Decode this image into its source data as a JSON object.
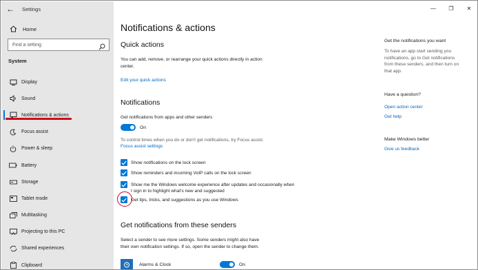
{
  "window": {
    "title": "Settings",
    "controls": [
      "—",
      "❐",
      "✕"
    ]
  },
  "sidebar": {
    "home_label": "Home",
    "search_placeholder": "Find a setting",
    "section_label": "System",
    "items": [
      {
        "label": "Display",
        "icon": "display-icon"
      },
      {
        "label": "Sound",
        "icon": "sound-icon"
      },
      {
        "label": "Notifications & actions",
        "icon": "notifications-icon",
        "active": true
      },
      {
        "label": "Focus assist",
        "icon": "focus-assist-icon"
      },
      {
        "label": "Power & sleep",
        "icon": "power-icon"
      },
      {
        "label": "Battery",
        "icon": "battery-icon"
      },
      {
        "label": "Storage",
        "icon": "storage-icon"
      },
      {
        "label": "Tablet mode",
        "icon": "tablet-icon"
      },
      {
        "label": "Multitasking",
        "icon": "multitasking-icon"
      },
      {
        "label": "Projecting to this PC",
        "icon": "projecting-icon"
      },
      {
        "label": "Shared experiences",
        "icon": "shared-icon"
      },
      {
        "label": "Clipboard",
        "icon": "clipboard-icon"
      }
    ]
  },
  "main": {
    "page_title": "Notifications & actions",
    "quick_actions": {
      "heading": "Quick actions",
      "description_line1": "You can add, remove, or rearrange your quick actions directly in action",
      "description_line2": "center.",
      "link": "Edit your quick actions"
    },
    "notifications": {
      "heading": "Notifications",
      "get_label": "Get notifications from apps and other senders",
      "toggle_state": "On",
      "focus_text": "To control times when you do or don't get notifications, try Focus assist.",
      "focus_link": "Focus assist settings",
      "checkboxes": [
        {
          "label": "Show notifications on the lock screen",
          "checked": true
        },
        {
          "label": "Show reminders and incoming VoIP calls on the lock screen",
          "checked": true
        },
        {
          "label": "Show me the Windows welcome experience after updates and occasionally when I sign in to highlight what's new and suggested",
          "checked": true
        },
        {
          "label": "Get tips, tricks, and suggestions as you use Windows",
          "checked": true
        }
      ]
    },
    "senders": {
      "heading": "Get notifications from these senders",
      "description_line1": "Select a sender to see more settings. Some senders might also have",
      "description_line2": "their own notification settings. If so, open the sender to change them.",
      "apps": [
        {
          "name": "Alarms & Clock",
          "state": "On"
        }
      ]
    }
  },
  "right_panel": {
    "get_heading": "Get the notifications you want",
    "get_text_line1": "To have an app start sending you",
    "get_text_line2": "notifications, go to Get notifications",
    "get_text_line3": "from these senders, and then turn on",
    "get_text_line4": "that app.",
    "question_heading": "Have a question?",
    "link_action_center": "Open action center",
    "link_help": "Get help",
    "better_heading": "Make Windows better",
    "link_feedback": "Give us feedback"
  },
  "colors": {
    "accent": "#0078d7",
    "link": "#0067c0",
    "annotation_red": "#d0021b",
    "sidebar_bg": "#e6e6e6"
  }
}
